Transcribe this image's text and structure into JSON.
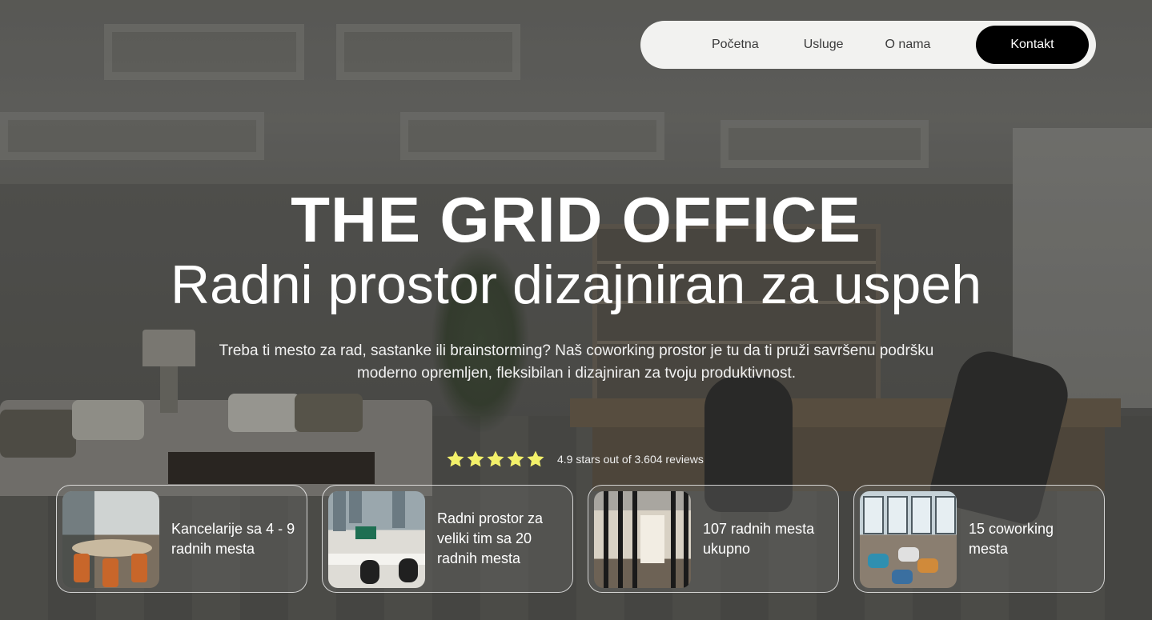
{
  "nav": {
    "links": [
      "Početna",
      "Usluge",
      "O nama"
    ],
    "cta_label": "Kontakt"
  },
  "hero": {
    "title": "THE GRID OFFICE",
    "subtitle": "Radni prostor dizajniran za uspeh",
    "description": "Treba ti mesto za rad, sastanke ili brainstorming? Naš coworking prostor je tu da ti pruži savršenu podršku moderno opremljen, fleksibilan i dizajniran za tvoju produktivnost."
  },
  "rating": {
    "stars": 5,
    "star_color": "#f2f06a",
    "text": "4.9 stars out of 3.604 reviews"
  },
  "cards": [
    {
      "text": "Kancelarije sa 4 - 9 radnih mesta",
      "image": "office-room-photo"
    },
    {
      "text": "Radni prostor za veliki tim sa 20 radnih mesta",
      "image": "team-workspace-photo"
    },
    {
      "text": "107 radnih mesta ukupno",
      "image": "hallway-photo"
    },
    {
      "text": "15 coworking mesta",
      "image": "lounge-photo"
    }
  ]
}
